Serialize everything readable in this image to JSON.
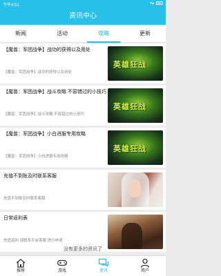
{
  "status_bar": {
    "time": "下午4:51"
  },
  "header": {
    "title": "资讯中心"
  },
  "tabs": [
    {
      "label": "新闻",
      "active": false
    },
    {
      "label": "活动",
      "active": false
    },
    {
      "label": "攻略",
      "active": true
    },
    {
      "label": "更新",
      "active": false
    }
  ],
  "list": [
    {
      "title": "【魔兽：军团战争】战功的获得以及用处",
      "subtitle": "【魔兽：军团战争】战功的获得以及用处",
      "thumb": "game-logo",
      "thumb_text": "英雄狂战"
    },
    {
      "title": "【魔兽：军团战争】战斗攻略 不容错过的小技巧",
      "subtitle": "【魔兽：军团战争】战斗攻略 不容错过的小技巧",
      "thumb": "game-logo",
      "thumb_text": "英雄狂战"
    },
    {
      "title": "【魔兽：军团战争】小白进服专用攻略",
      "subtitle": "【魔兽：军团战争】小白进服专用攻略",
      "thumb": "game-logo",
      "thumb_text": "英雄狂战"
    },
    {
      "title": "充值不到账及时联系客服",
      "subtitle": "充值不到账及时联系客服",
      "thumb": "elf-art",
      "thumb_text": ""
    },
    {
      "title": "日常返利表",
      "subtitle": "充值返利 请联系平台客服 进行申请",
      "thumb": "war-art",
      "thumb_text": ""
    }
  ],
  "more_hint": "没有更多的资讯了",
  "bottom_nav": [
    {
      "label": "推荐",
      "icon": "home-icon",
      "active": false
    },
    {
      "label": "游戏",
      "icon": "gamepad-icon",
      "active": false
    },
    {
      "label": "资讯",
      "icon": "chat-icon",
      "active": true
    },
    {
      "label": "用户",
      "icon": "user-icon",
      "active": false
    }
  ],
  "colors": {
    "accent": "#26c0e9",
    "active_tab": "#22b9e6"
  }
}
